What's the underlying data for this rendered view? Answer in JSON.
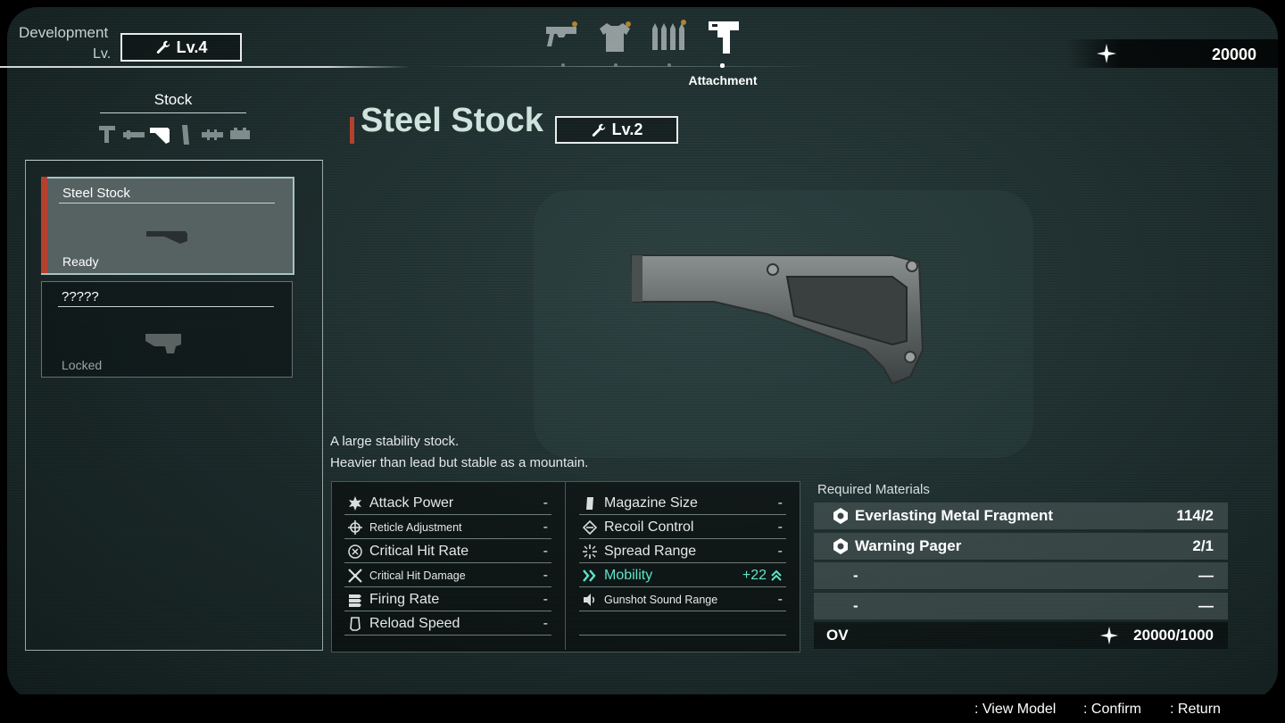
{
  "header": {
    "dev_label_line1": "Development",
    "dev_label_line2": "Lv.",
    "dev_level": "Lv.4",
    "active_tab_label": "Attachment",
    "currency_value": "20000",
    "tabs": [
      "handgun-icon",
      "armor-icon",
      "ammo-icon",
      "attachment-icon"
    ]
  },
  "sidebar": {
    "category_title": "Stock",
    "category_icons": [
      "grip-icon",
      "barrel-icon",
      "stock-icon",
      "magazine-icon",
      "muzzle-icon",
      "scope-icon"
    ],
    "items": [
      {
        "name": "Steel Stock",
        "status": "Ready"
      },
      {
        "name": "?????",
        "status": "Locked"
      }
    ]
  },
  "detail": {
    "title": "Steel Stock",
    "level": "Lv.2",
    "description_line1": "A large stability stock.",
    "description_line2": "Heavier than lead but stable as a mountain."
  },
  "stats": {
    "left": [
      {
        "label": "Attack Power",
        "value": "-"
      },
      {
        "label": "Reticle Adjustment",
        "value": "-"
      },
      {
        "label": "Critical Hit Rate",
        "value": "-"
      },
      {
        "label": "Critical Hit Damage",
        "value": "-"
      },
      {
        "label": "Firing Rate",
        "value": "-"
      },
      {
        "label": "Reload Speed",
        "value": "-"
      }
    ],
    "right": [
      {
        "label": "Magazine Size",
        "value": "-"
      },
      {
        "label": "Recoil Control",
        "value": "-"
      },
      {
        "label": "Spread Range",
        "value": "-"
      },
      {
        "label": "Mobility",
        "value": "+22"
      },
      {
        "label": "Gunshot Sound Range",
        "value": "-"
      }
    ]
  },
  "materials": {
    "title": "Required Materials",
    "items": [
      {
        "name": "Everlasting Metal Fragment",
        "value": "114/2"
      },
      {
        "name": "Warning Pager",
        "value": "2/1"
      },
      {
        "name": "-",
        "value": "—"
      },
      {
        "name": "-",
        "value": "—"
      }
    ],
    "ov_label": "OV",
    "ov_value": "20000/1000"
  },
  "footer": {
    "view_model": "View Model",
    "confirm": "Confirm",
    "return": "Return"
  },
  "colors": {
    "accent_red": "#b5402f",
    "highlight_teal": "#5fe3c8",
    "title_mint": "#cfe3dc"
  }
}
